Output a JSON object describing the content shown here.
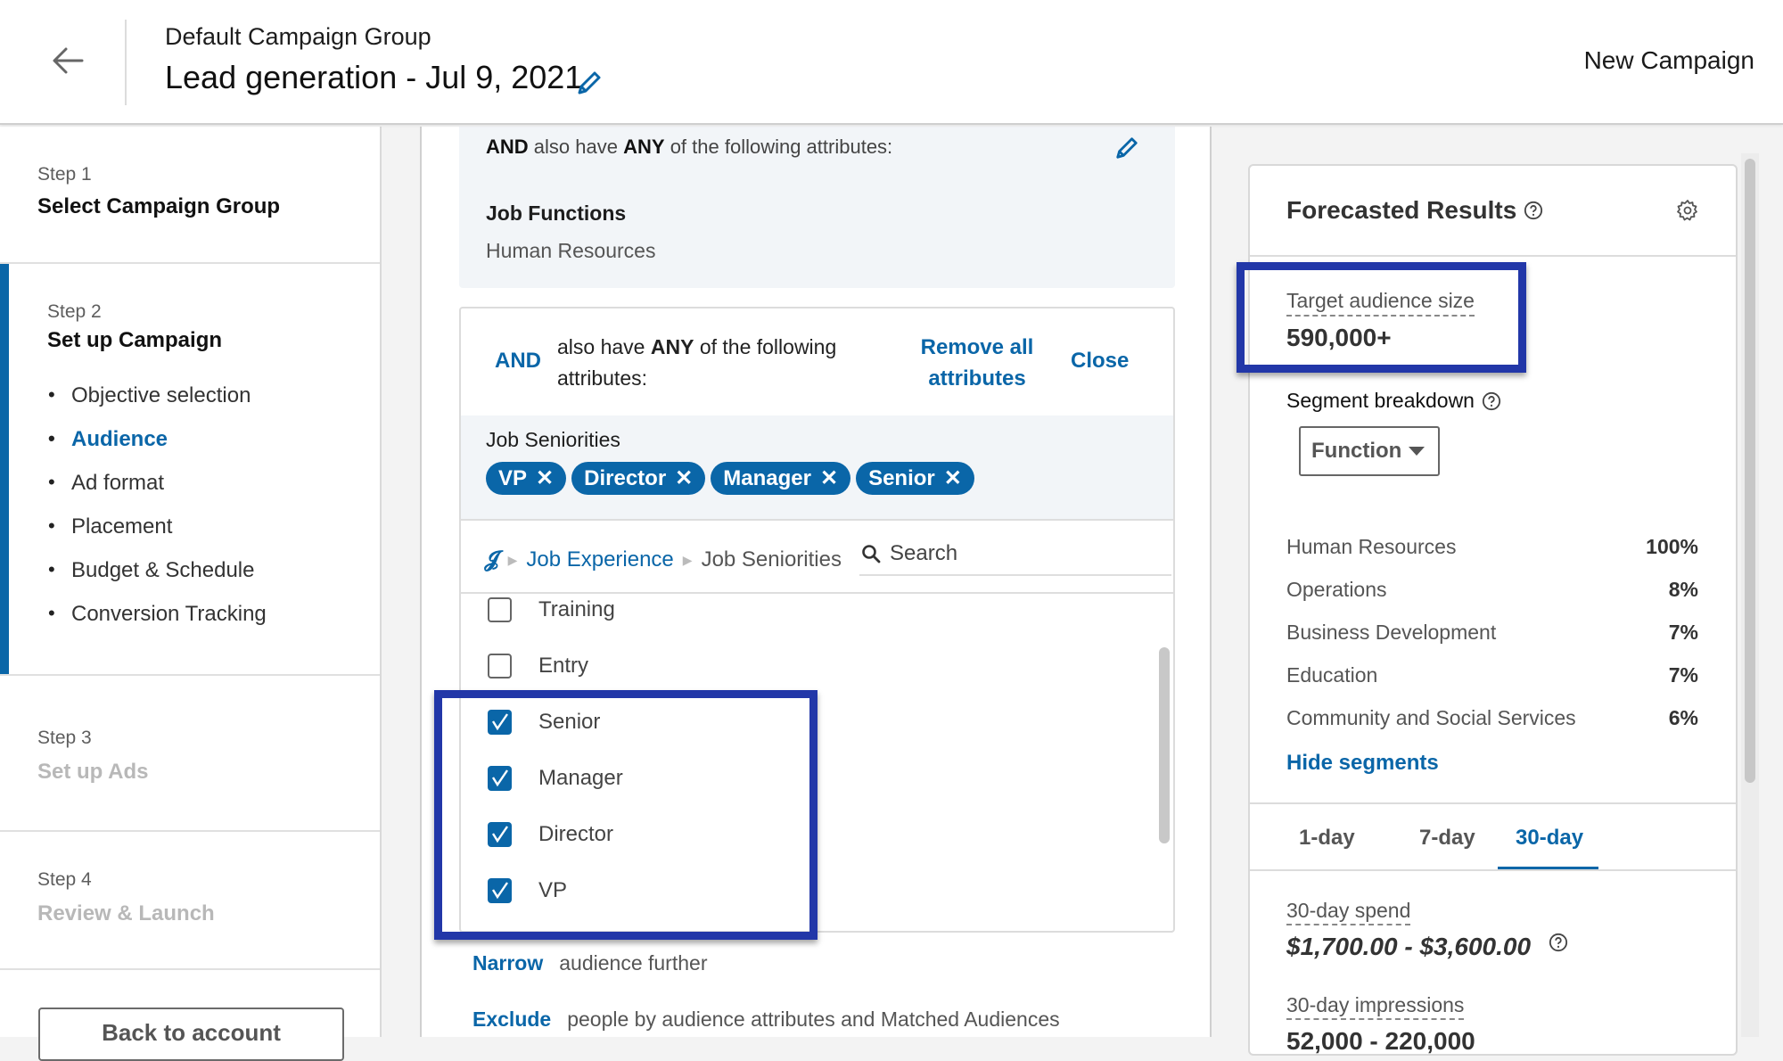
{
  "header": {
    "back_icon": "arrow-left-icon",
    "group_name": "Default Campaign Group",
    "campaign_title": "Lead generation - Jul 9, 2021",
    "edit_icon": "pencil-icon",
    "page_label": "New Campaign"
  },
  "sidebar": {
    "steps": [
      {
        "number": "Step 1",
        "title": "Select Campaign Group"
      },
      {
        "number": "Step 2",
        "title": "Set up Campaign",
        "substeps": [
          "Objective selection",
          "Audience",
          "Ad format",
          "Placement",
          "Budget & Schedule",
          "Conversion Tracking"
        ],
        "active_substep": "Audience"
      },
      {
        "number": "Step 3",
        "title": "Set up Ads"
      },
      {
        "number": "Step 4",
        "title": "Review & Launch"
      }
    ],
    "back_button": "Back to account"
  },
  "audience": {
    "saved_group": {
      "and": "AND",
      "also_have": "also have",
      "any": "ANY",
      "of_following": "of the following attributes:",
      "category": "Job Functions",
      "value": "Human Resources"
    },
    "editing_group": {
      "and": "AND",
      "description_pre": "also have",
      "any": "ANY",
      "description_post": "of the following attributes:",
      "remove_all": "Remove all attributes",
      "close": "Close",
      "selected_label": "Job Seniorities",
      "selected": [
        "VP",
        "Director",
        "Manager",
        "Senior"
      ],
      "breadcrumb": [
        "Job Experience",
        "Job Seniorities"
      ],
      "search_placeholder": "Search",
      "options": [
        {
          "label": "Training",
          "checked": false
        },
        {
          "label": "Entry",
          "checked": false
        },
        {
          "label": "Senior",
          "checked": true
        },
        {
          "label": "Manager",
          "checked": true
        },
        {
          "label": "Director",
          "checked": true
        },
        {
          "label": "VP",
          "checked": true
        }
      ]
    },
    "narrow": {
      "link": "Narrow",
      "text": "audience further"
    },
    "exclude": {
      "link": "Exclude",
      "text": "people by audience attributes and Matched Audiences"
    }
  },
  "forecast": {
    "title": "Forecasted Results",
    "target_audience_label": "Target audience size",
    "target_audience_value": "590,000+",
    "segment_label": "Segment breakdown",
    "segment_select": "Function",
    "segments": [
      {
        "name": "Human Resources",
        "pct": "100%"
      },
      {
        "name": "Operations",
        "pct": "8%"
      },
      {
        "name": "Business Development",
        "pct": "7%"
      },
      {
        "name": "Education",
        "pct": "7%"
      },
      {
        "name": "Community and Social Services",
        "pct": "6%"
      }
    ],
    "hide_segments": "Hide segments",
    "tabs": [
      "1-day",
      "7-day",
      "30-day"
    ],
    "active_tab": "30-day",
    "spend_label": "30-day spend",
    "spend_value": "$1,700.00 - $3,600.00",
    "impressions_label": "30-day impressions",
    "impressions_value": "52,000 - 220,000"
  },
  "colors": {
    "accent": "#0a66a8",
    "highlight_box": "#2237a8",
    "panel_bg": "#f2f5f8"
  }
}
